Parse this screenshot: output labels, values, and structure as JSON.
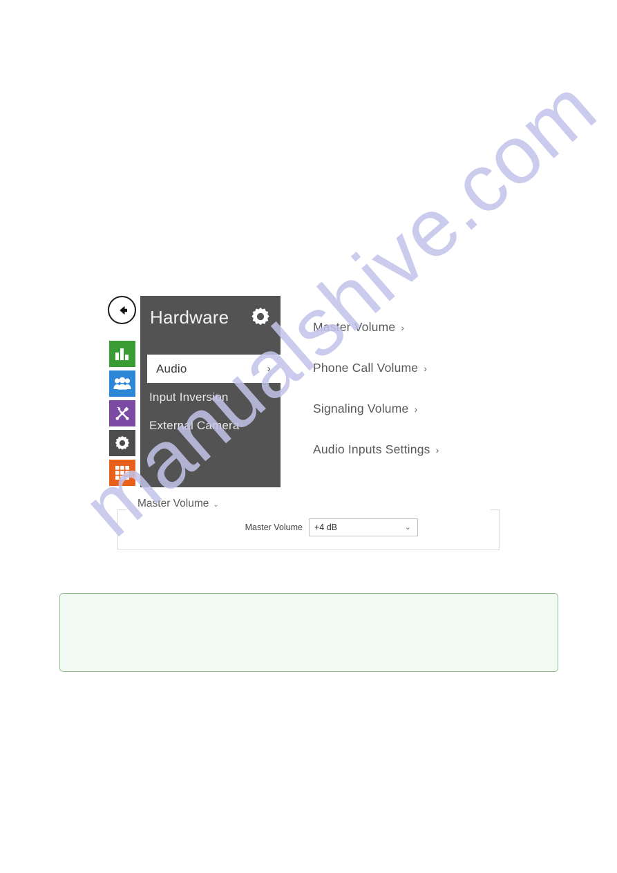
{
  "watermark": {
    "text": "manualshive.com",
    "color": "#c3c3ea"
  },
  "device_ui": {
    "back_button": {
      "icon": "arrow-left-icon",
      "label": "Back"
    },
    "sidebar": {
      "items": [
        {
          "icon": "bar-chart-icon",
          "label": "Status",
          "color": "#3a9c35"
        },
        {
          "icon": "users-icon",
          "label": "Directory",
          "color": "#2e86d6"
        },
        {
          "icon": "tools-icon",
          "label": "Hardware",
          "color": "#7b4ba3"
        },
        {
          "icon": "gear-icon",
          "label": "Services",
          "color": "#4d4d4d"
        },
        {
          "icon": "grid-icon",
          "label": "System",
          "color": "#e8611c"
        }
      ]
    },
    "menu_panel": {
      "title": "Hardware",
      "header_icon": "gear-icon",
      "items": [
        {
          "label": "Audio",
          "chevron": "›",
          "active": true
        },
        {
          "label": "Input Inversion",
          "chevron": "",
          "active": false
        },
        {
          "label": "External Camera",
          "chevron": "",
          "active": false
        }
      ]
    },
    "submenu": {
      "items": [
        {
          "label": "Master Volume",
          "chevron": "›"
        },
        {
          "label": "Phone Call Volume",
          "chevron": "›"
        },
        {
          "label": "Signaling Volume",
          "chevron": "›"
        },
        {
          "label": "Audio Inputs Settings",
          "chevron": "›"
        }
      ]
    }
  },
  "settings_form": {
    "section_title": "Master Volume",
    "section_caret": "⌄",
    "field": {
      "label": "Master Volume",
      "value": "+4 dB",
      "caret": "⌄",
      "options": [
        "+4 dB"
      ]
    }
  },
  "note_box": {
    "text": "",
    "border_color": "#8cc08c",
    "background_color": "#f2f8f2"
  }
}
